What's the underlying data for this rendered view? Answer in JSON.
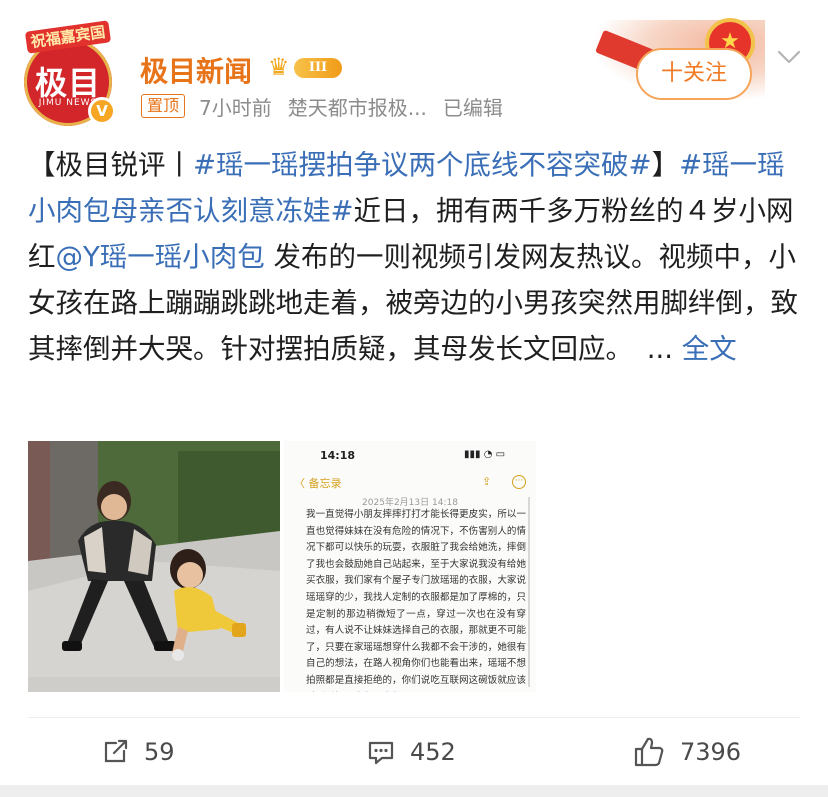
{
  "account": {
    "avatar_banner": "祝福嘉宾国",
    "avatar_logo": "极目",
    "avatar_sub": "JIMU NEWS",
    "verified_mark": "V",
    "name": "极目新闻",
    "vip_level": "III",
    "follow_label": "十关注"
  },
  "post_meta": {
    "pinned_tag": "置顶",
    "time": "7小时前",
    "source": "楚天都市报极...",
    "edited": "已编辑"
  },
  "post": {
    "prefix": "【极目锐评丨",
    "hashtag_1": "#瑶一瑶摆拍争议两个底线不容突破#",
    "bracket_close": "】",
    "hashtag_2": "#瑶一瑶小肉包母亲否认刻意冻娃#",
    "text_1": "近日，拥有两千多万粉丝的４岁小网红",
    "mention": "@Y瑶一瑶小肉包",
    "text_2": " 发布的一则视频引发网友热议。视频中，小女孩在路上蹦蹦跳跳地走着，被旁边的小男孩突然用脚绊倒，致其摔倒并大哭。针对摆拍质疑，其母发长文回应。　... ",
    "expand_link": "全文"
  },
  "media_screenshot": {
    "time": "14:18",
    "back_label": "〈 备忘录",
    "date": "2025年2月13日 14:18",
    "paragraph": "我一直觉得小朋友摔摔打打才能长得更皮实，所以一直也觉得妹妹在没有危险的情况下，不伤害别人的情况下都可以快乐的玩耍，衣服脏了我会给她洗，摔倒了我也会鼓励她自己站起来，至于大家说我没有给她买衣服，我们家有个屋子专门放瑶瑶的衣服，大家说瑶瑶穿的少，我找人定制的衣服都是加了厚棉的，只是定制的那边稍微短了一点，穿过一次也在没有穿过，有人说不让妹妹选择自己的衣服，那就更不可能了，只要在家瑶瑶想穿什么我都不会干涉的，她很有自己的想法，在路人视角你们也能看出来，瑶瑶不想拍照都是直接拒绝的，你们说吃互联网这碗饭就应该对瑶瑶好，我们尽我们最"
  },
  "actions": {
    "repost_count": "59",
    "comment_count": "452",
    "like_count": "7396"
  },
  "colors": {
    "username": "#e8741a",
    "link": "#3a6fb7",
    "follow": "#f07b24"
  }
}
